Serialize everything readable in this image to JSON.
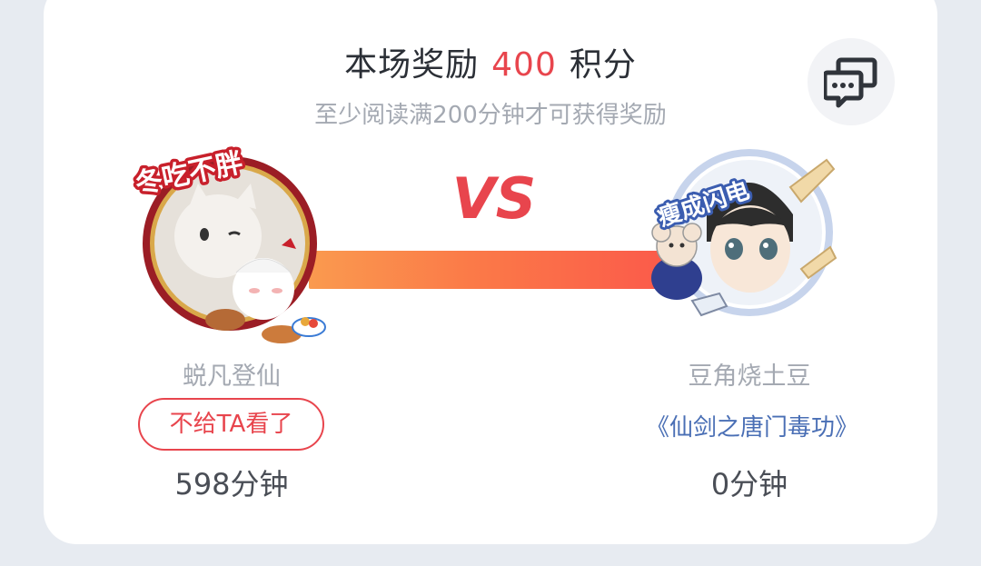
{
  "reward": {
    "prefix": "本场奖励",
    "points": "400",
    "suffix": "积分",
    "condition": "至少阅读满200分钟才可获得奖励"
  },
  "versus": {
    "label": "VS"
  },
  "left_player": {
    "name": "蜕凡登仙",
    "badge_text": "冬吃不胖",
    "status_button": "不给TA看了",
    "minutes": "598分钟"
  },
  "right_player": {
    "name": "豆角烧土豆",
    "badge_text": "瘦成闪电",
    "book_title": "《仙剑之唐门毒功》",
    "minutes": "0分钟"
  },
  "icons": {
    "chat": "chat-bubble-icon"
  },
  "colors": {
    "accent_red": "#e8454d",
    "link_blue": "#4a6fb5",
    "bar_start": "#fa9a4f",
    "bar_end": "#fb5a4a"
  }
}
